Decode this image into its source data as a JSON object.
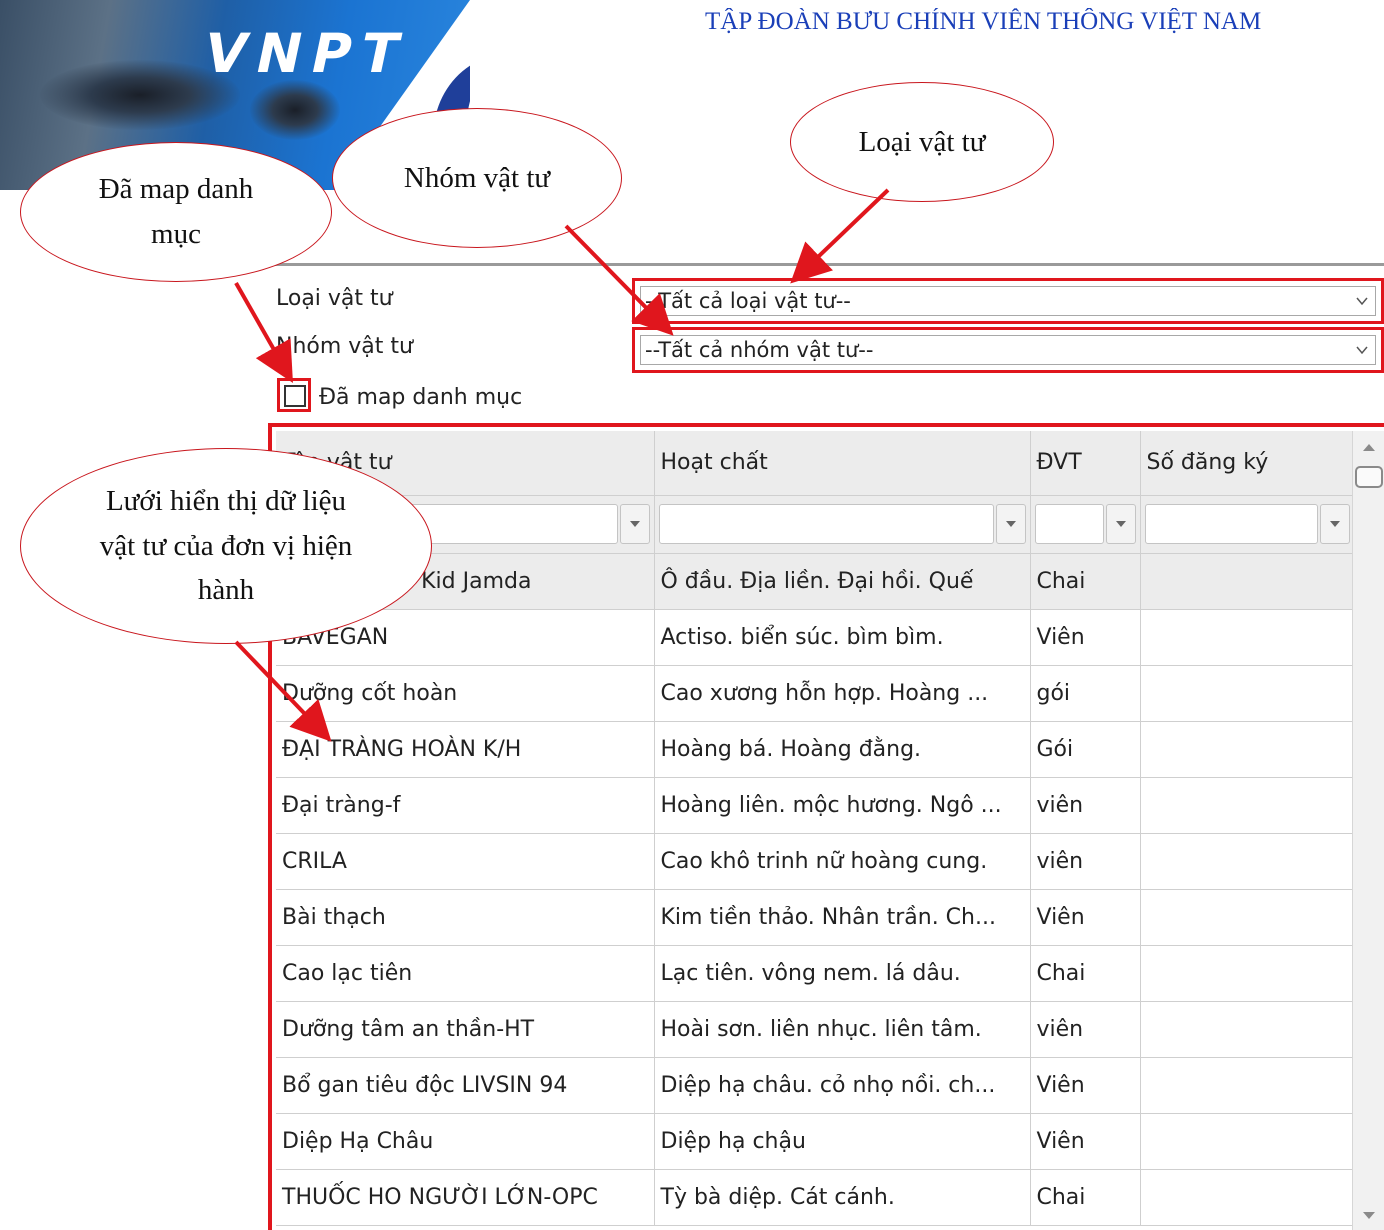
{
  "header": {
    "logo_text": "VNPT",
    "org_title": "TẬP ĐOÀN BƯU CHÍNH VIỄN THÔNG VIỆT NAM"
  },
  "callouts": {
    "loai_vat_tu": "Loại vật tư",
    "nhom_vat_tu": "Nhóm vật tư",
    "da_map": "Đã map danh mục",
    "luoi": "Lưới hiển thị dữ liệu vật tư của đơn vị hiện hành"
  },
  "filters": {
    "loai_label": "Loại vật tư",
    "loai_value": "--Tất cả loại vật tư--",
    "nhom_label": "Nhóm vật tư",
    "nhom_value": "--Tất cả nhóm vật tư--",
    "map_label": "Đã map danh mục",
    "map_checked": false
  },
  "grid": {
    "columns": [
      "Tên vật tư",
      "Hoạt chất",
      "ĐVT",
      "Số đăng ký"
    ],
    "rows": [
      [
        "Siro Bổ phổi Kid Jamda",
        "Ô đầu. Địa liền. Đại hồi. Quế",
        "Chai",
        ""
      ],
      [
        "BAVEGAN",
        "Actiso. biển súc. bìm bìm.",
        "Viên",
        ""
      ],
      [
        "Dưỡng cốt hoàn",
        "Cao xương hỗn hợp. Hoàng ...",
        "gói",
        ""
      ],
      [
        "ĐẠI TRÀNG HOÀN K/H",
        "Hoàng bá. Hoàng đằng.",
        "Gói",
        ""
      ],
      [
        "Đại tràng-f",
        "Hoàng liên. mộc hương. Ngô ...",
        "viên",
        ""
      ],
      [
        "CRILA",
        "Cao khô trinh nữ hoàng cung.",
        "viên",
        ""
      ],
      [
        "Bài thạch",
        "Kim tiền thảo. Nhân trần. Ch...",
        "Viên",
        ""
      ],
      [
        "Cao lạc tiên",
        "Lạc tiên. vông nem. lá dâu.",
        "Chai",
        ""
      ],
      [
        "Dưỡng tâm an thần-HT",
        "Hoài sơn. liên nhục. liên tâm.",
        "viên",
        ""
      ],
      [
        "Bổ gan tiêu độc LIVSIN 94",
        "Diệp hạ châu. cỏ nhọ nồi. ch...",
        "Viên",
        ""
      ],
      [
        "Diệp Hạ Châu",
        "Diệp hạ chậu",
        "Viên",
        ""
      ],
      [
        "THUỐC HO NGƯỜI LỚN-OPC",
        "Tỳ bà diệp. Cát cánh.",
        "Chai",
        ""
      ]
    ]
  },
  "colors": {
    "annotation_red": "#e0161d",
    "title_blue": "#1a3fb8",
    "header_gray": "#ececec"
  }
}
